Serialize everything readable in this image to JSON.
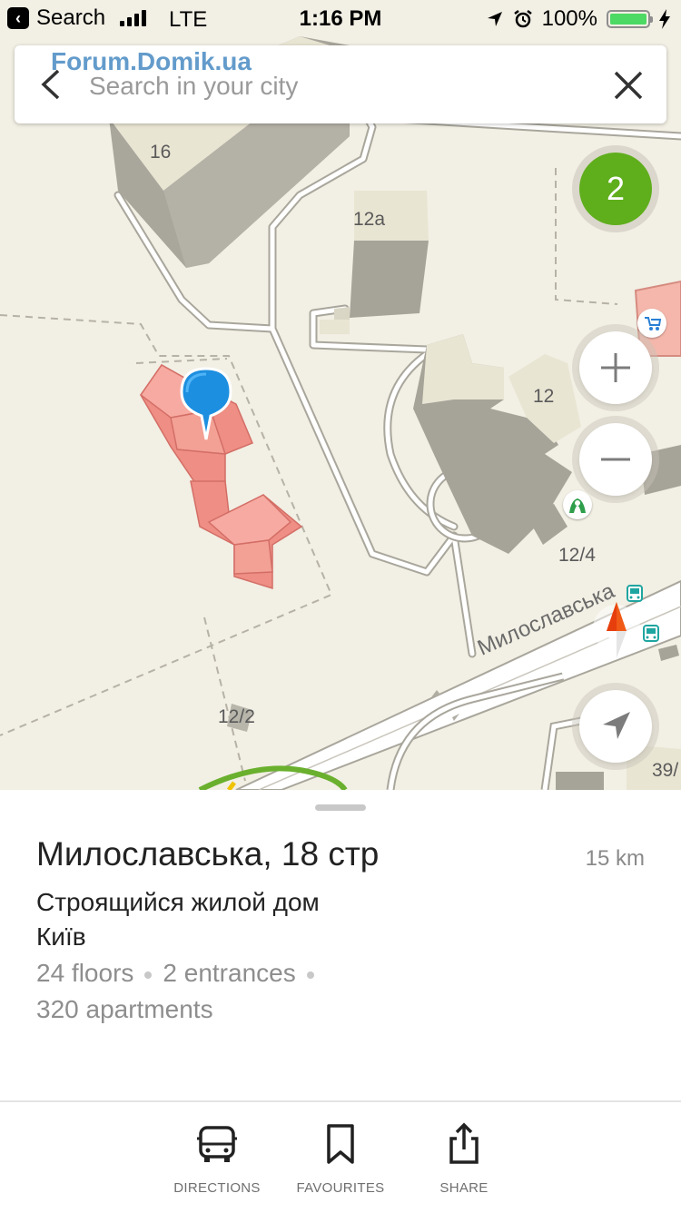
{
  "status_bar": {
    "back_app": "Search",
    "network": "LTE",
    "time": "1:16 PM",
    "battery": "100%"
  },
  "search": {
    "placeholder": "Search in your city"
  },
  "watermark": "Forum.Domik.ua",
  "map": {
    "cluster_count": "2",
    "building_labels": [
      "16",
      "12а",
      "12",
      "12/4",
      "12/2",
      "39/"
    ],
    "street_name": "Милославська"
  },
  "place": {
    "title": "Милославська, 18 стр",
    "distance": "15 km",
    "subtitle": "Строящийся жилой дом",
    "city": "Київ",
    "floors": "24 floors",
    "entrances": "2 entrances",
    "apartments": "320 apartments"
  },
  "toolbar": {
    "directions": "DIRECTIONS",
    "favourites": "FAVOURITES",
    "share": "SHARE"
  },
  "colors": {
    "map_bg": "#f2efe4",
    "selected_building": "#f48f86",
    "pin": "#1d8fe0",
    "cluster": "#5fae1c"
  }
}
